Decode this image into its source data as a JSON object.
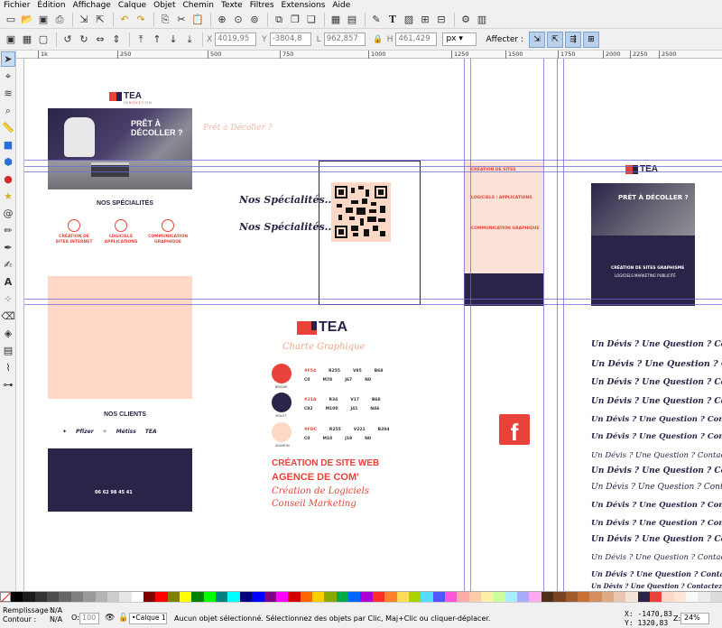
{
  "menu": [
    "Fichier",
    "Édition",
    "Affichage",
    "Calque",
    "Objet",
    "Chemin",
    "Texte",
    "Filtres",
    "Extensions",
    "Aide"
  ],
  "controls": {
    "x_label": "X",
    "x_value": "4019,95",
    "y_label": "Y",
    "y_value": "-3804,8",
    "w_label": "L",
    "w_value": "962,857",
    "h_label": "H",
    "h_value": "461,429",
    "unit": "px",
    "affecter_label": "Affecter :"
  },
  "ruler": [
    "1k",
    "250",
    "500",
    "750",
    "1000",
    "1250",
    "1500",
    "1750",
    "2000",
    "2250",
    "2500"
  ],
  "canvas": {
    "logo_word": "TEA",
    "logo_sub": "INNOVATION",
    "hero_title": "PRÊT À DÉCOLLER ?",
    "faint_script": "Prêt à Décoller ?",
    "specialites_title": "NOS SPÉCIALITÉS",
    "spec": [
      {
        "title": "CRÉATION DE SITES INTERNET"
      },
      {
        "title": "LOGICIELS APPLICATIONS"
      },
      {
        "title": "COMMUNICATION GRAPHIQUE"
      }
    ],
    "script_specialites": "Nos Spécialités...",
    "clients_title": "NOS CLIENTS",
    "clients": [
      "✦",
      "Pfizer",
      "✧",
      "Métiss",
      "TEA"
    ],
    "footer_phone": "06 62 98 45 41",
    "charte_title": "Charte Graphique",
    "colors": [
      {
        "hex": "#e8423a",
        "name": "BRIQUE",
        "code": "#F54",
        "r": "R255",
        "g": "V85",
        "b": "B68",
        "c": "C0",
        "m": "M78",
        "y": "J67",
        "k": "N0"
      },
      {
        "hex": "#2b2348",
        "name": "VIOLET",
        "code": "#21A",
        "r": "R34",
        "g": "V17",
        "b": "B68",
        "c": "C82",
        "m": "M100",
        "y": "J41",
        "k": "N46"
      },
      {
        "hex": "#fdd8c6",
        "name": "SAUMON",
        "code": "#FDC",
        "r": "R255",
        "g": "V221",
        "b": "B204",
        "c": "C0",
        "m": "M18",
        "y": "J19",
        "k": "N0"
      }
    ],
    "font_samples": [
      "CRÉATION DE SITE WEB",
      "AGENCE DE COM'",
      "Création de Logiciels",
      "Conseil Marketing"
    ],
    "flyer_sections": [
      "CRÉATION DE SITES",
      "LOGICIELS / APPLICATIONS",
      "COMMUNICATION GRAPHIQUE"
    ],
    "poster_title": "PRÊT À DÉCOLLER ?",
    "poster_sub1": "CRÉATION DE SITES   GRAPHISME",
    "poster_sub2": "LOGICIELS   MARKETING   PUBLICITÉ",
    "facebook": "f",
    "devis": [
      "Un Dévis ? Une Question ? Contactez",
      "Un Dévis ? Une Question ? Contactez",
      "Un Dévis ? Une Question ? Contactez",
      "Un Dévis ? Une Question ? Contactez",
      "Un Dévis ? Une Question ? Contactez",
      "Un Dévis ? Une Question ? Contactez",
      "Un Dévis ? Une Question ? Contactez",
      "Un Dévis ? Une Question ? Contactez",
      "Un Dévis ? Une Question ? Contactez",
      "Un Dévis ? Une Question ? Contactez",
      "Un Dévis ? Une Question ? Contactez",
      "Un Dévis ? Une Question ? Contactez",
      "Un Dévis ? Une Question ? Contactez",
      "Un Dévis ? Une Question ? Contactez",
      "Un Dévis ? Une Question ? Contactez",
      "Un Dévis ? Une Question ? Contactez",
      "Un Dévis ? Une Question ? Contactez"
    ]
  },
  "palette_colors": [
    "#000000",
    "#1a1a1a",
    "#333333",
    "#4d4d4d",
    "#666666",
    "#808080",
    "#999999",
    "#b3b3b3",
    "#cccccc",
    "#e6e6e6",
    "#ffffff",
    "#800000",
    "#ff0000",
    "#808000",
    "#ffff00",
    "#008000",
    "#00ff00",
    "#008080",
    "#00ffff",
    "#000080",
    "#0000ff",
    "#800080",
    "#ff00ff",
    "#d40000",
    "#ff6600",
    "#ffcc00",
    "#88aa00",
    "#00aa44",
    "#0066ff",
    "#aa00d4",
    "#ff2a2a",
    "#ff7f2a",
    "#ffdd55",
    "#aad400",
    "#55ddff",
    "#5555ff",
    "#ff55dd",
    "#ffaaaa",
    "#ffccaa",
    "#ffeeaa",
    "#ccff99",
    "#aaeeff",
    "#aaaaff",
    "#ffaaee",
    "#502d16",
    "#784421",
    "#a05a2c",
    "#c87137",
    "#d38d5f",
    "#deaa87",
    "#e9c6af",
    "#f4e3d7",
    "#2b2348",
    "#e8423a",
    "#fdd8c6",
    "#ffe6d5",
    "#f9f9f9",
    "#ececec",
    "#dcdcdc"
  ],
  "status": {
    "fill_label": "Remplissage :",
    "fill_value": "N/A",
    "stroke_label": "Contour :",
    "stroke_value": "N/A",
    "opacity_label": "O:",
    "opacity_value": "100",
    "layer": "•Calque 1",
    "message": "Aucun objet sélectionné. Sélectionnez des objets par Clic, Maj+Clic ou cliquer-déplacer.",
    "x_coord": "X: -1470,83",
    "y_coord": "Y:  1320,83",
    "zoom_label": "Z:",
    "zoom": "24%"
  }
}
